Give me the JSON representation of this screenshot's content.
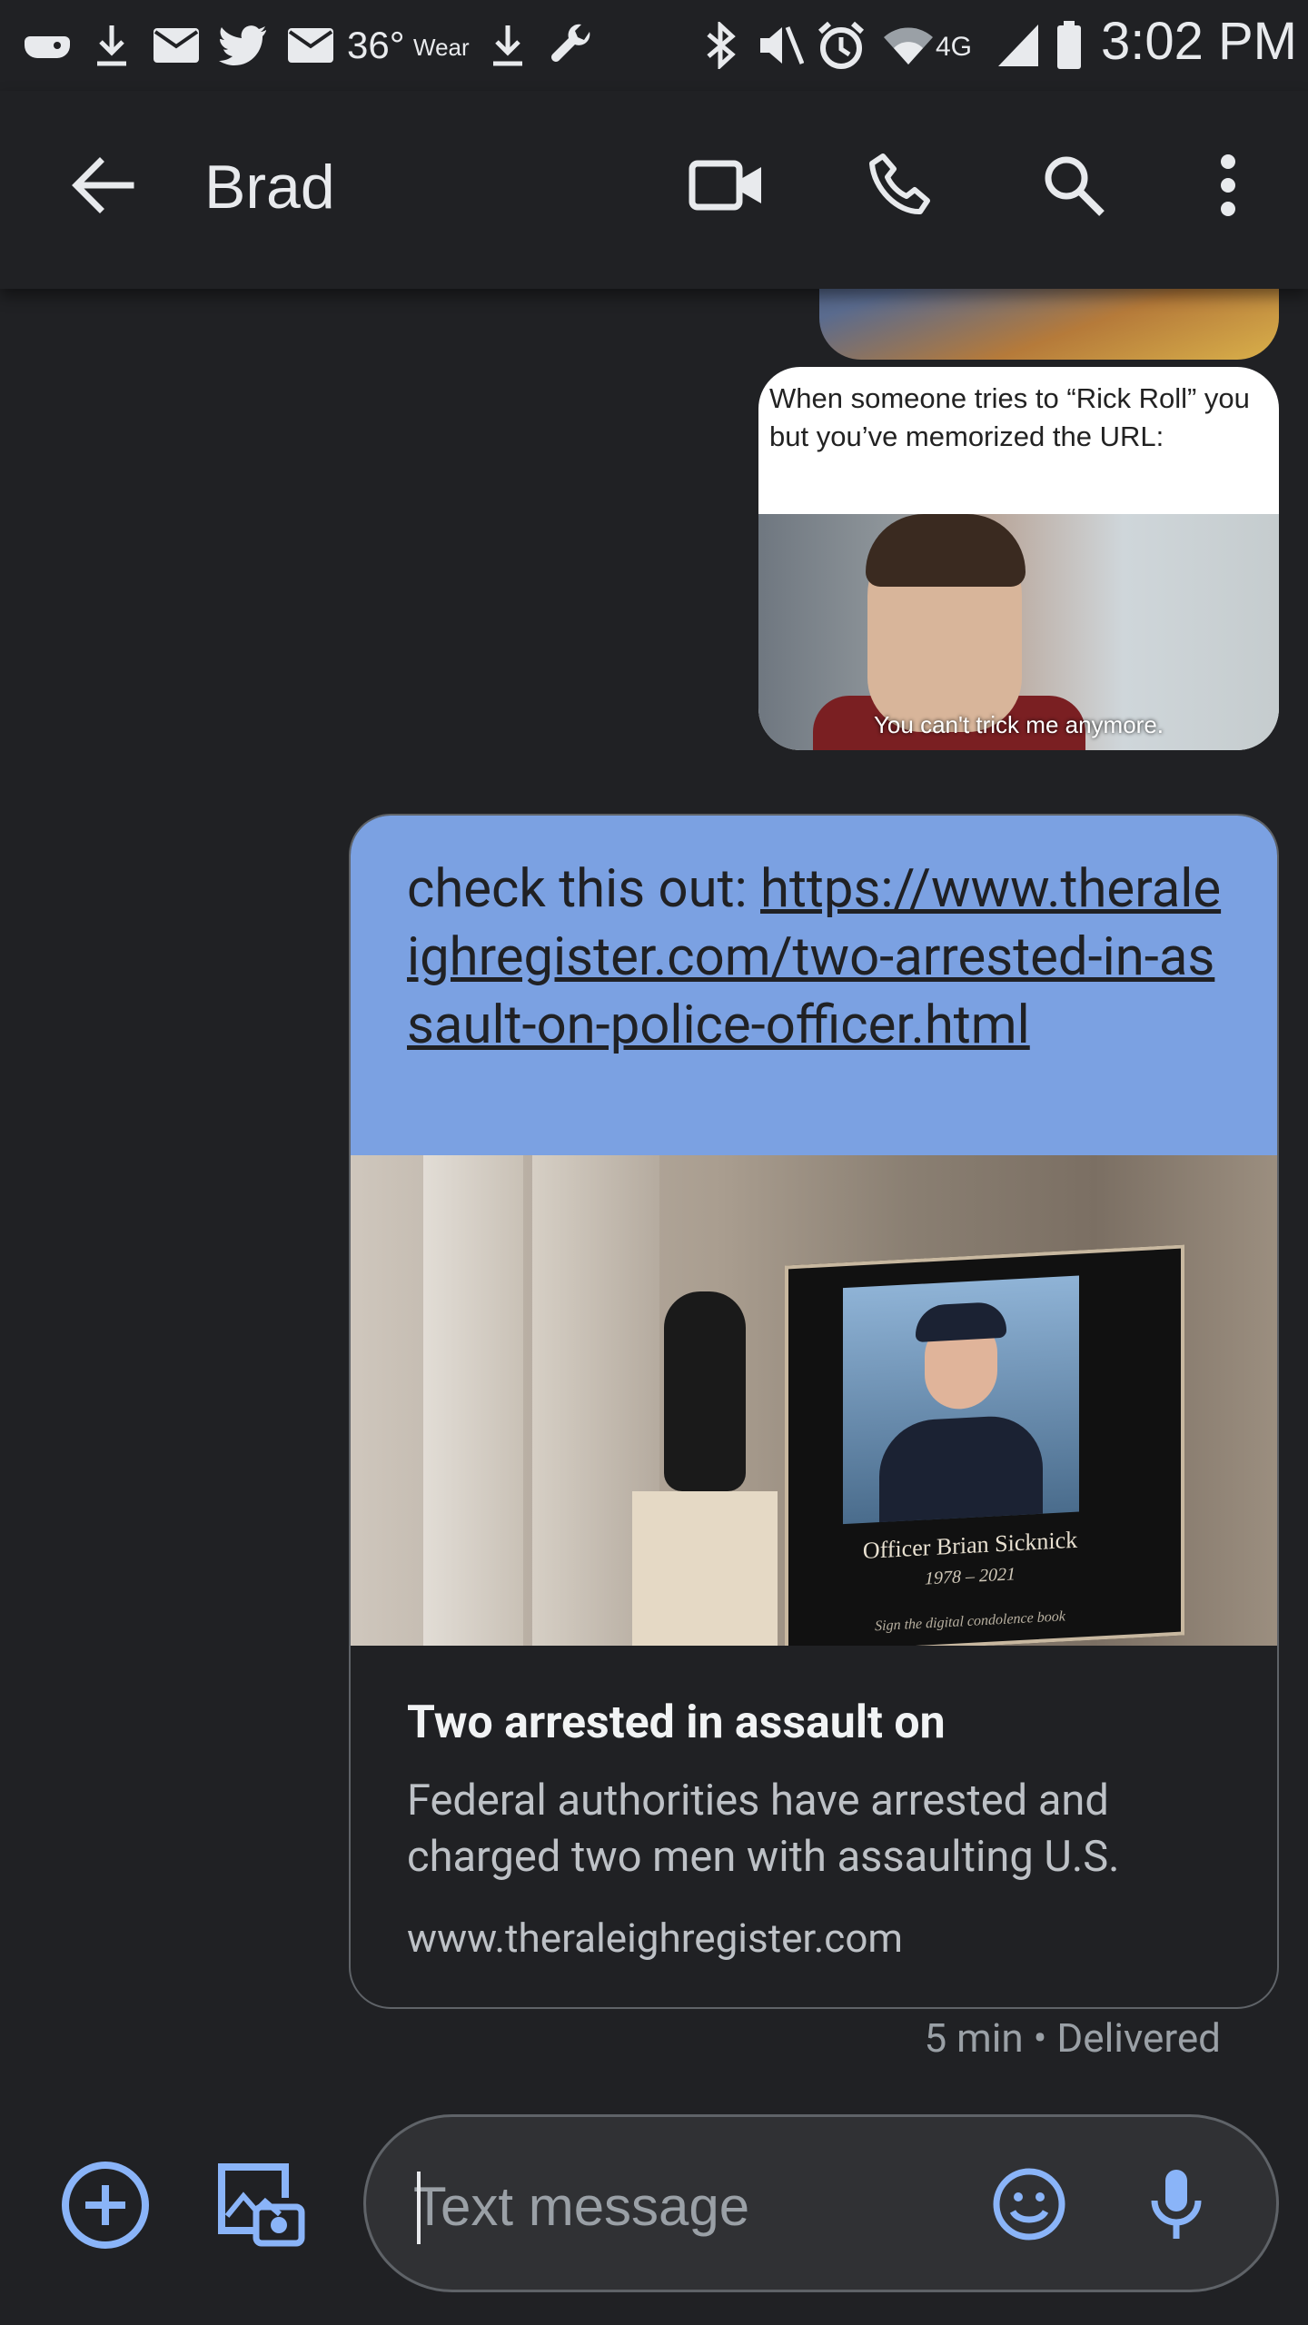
{
  "status_bar": {
    "temperature": "36°",
    "wear_label": "Wear",
    "network": "4G",
    "time": "3:02 PM"
  },
  "app_bar": {
    "contact_name": "Brad"
  },
  "conversation": {
    "meme": {
      "caption": "When someone tries to “Rick Roll” you but you’ve memorized the URL:",
      "subtitle": "You can't trick me anymore."
    },
    "link_message": {
      "text_prefix": "check this out: ",
      "url_text": "https://www.theraleighregister.com/two-arrested-in-assault-on-police-officer.html",
      "preview": {
        "frame_name": "Officer Brian Sicknick",
        "frame_years": "1978 – 2021",
        "frame_footer": "Sign the digital condolence book",
        "title": "Two arrested in assault on",
        "description": "Federal authorities have arrested and charged two men with assaulting U.S.",
        "domain": "www.theraleighregister.com"
      },
      "status": "5 min • Delivered"
    }
  },
  "compose": {
    "placeholder": "Text message"
  },
  "colors": {
    "background": "#202124",
    "outgoing_bubble": "#7ba1e2",
    "accent_icon": "#8ab4f8",
    "text_primary": "#e8eaed",
    "text_secondary": "#9aa0a6"
  },
  "icons": [
    "back-arrow-icon",
    "video-call-icon",
    "phone-icon",
    "search-icon",
    "more-vert-icon",
    "add-circle-icon",
    "gallery-camera-icon",
    "emoji-icon",
    "mic-icon"
  ]
}
